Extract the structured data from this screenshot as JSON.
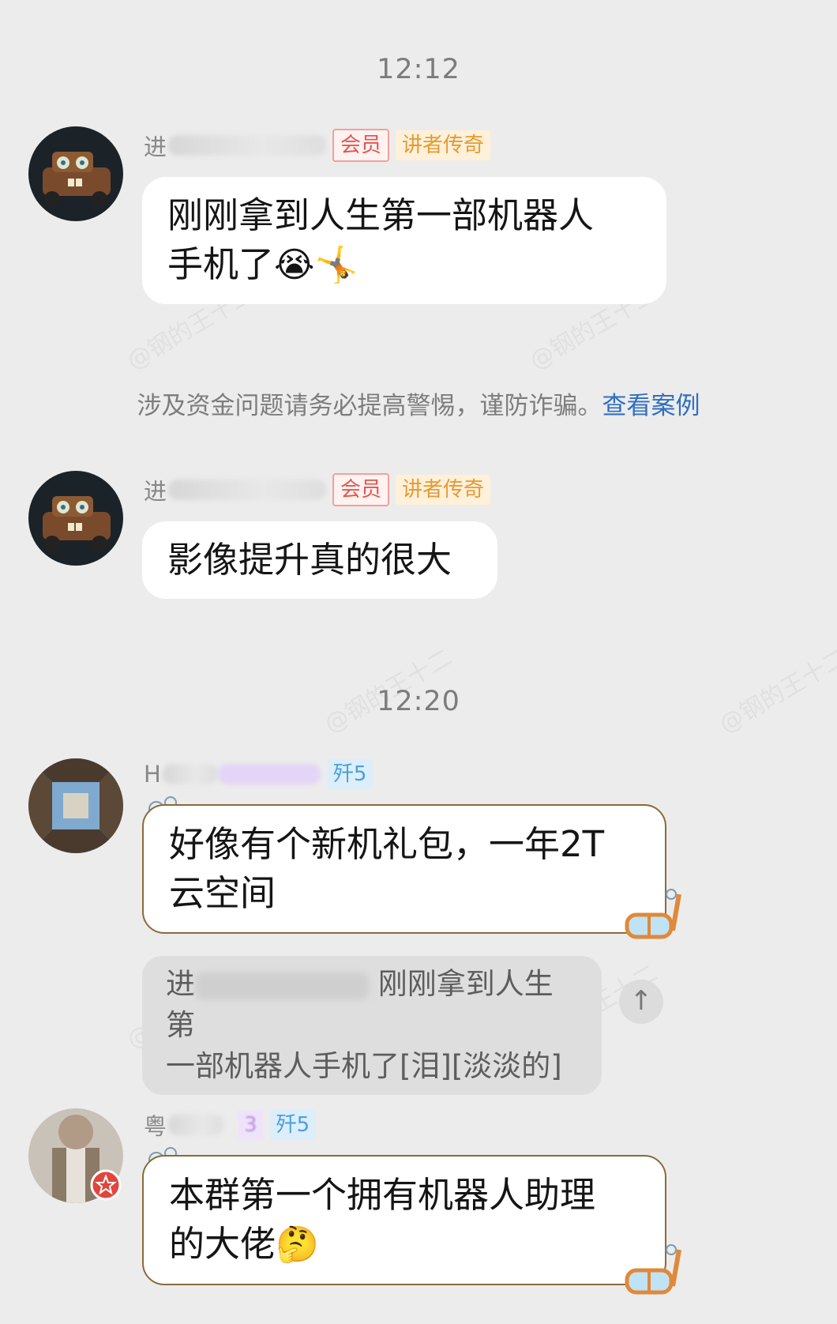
{
  "messages": [
    {
      "type": "time",
      "text": "12:12"
    },
    {
      "type": "chat",
      "name_initial": "进",
      "badges": [
        "会员",
        "讲者传奇"
      ],
      "text_line1": "刚刚拿到人生第一部机器人",
      "text_line2": "手机了",
      "emojis": [
        "😭",
        "🤸"
      ]
    },
    {
      "type": "notice",
      "text": "涉及资金问题请务必提高警惕，谨防诈骗。",
      "link": "查看案例"
    },
    {
      "type": "chat",
      "name_initial": "进",
      "badges": [
        "会员",
        "讲者传奇"
      ],
      "text": "影像提升真的很大"
    },
    {
      "type": "time",
      "text": "12:20"
    },
    {
      "type": "chat",
      "name_initial": "H",
      "badges": [
        "歼5"
      ],
      "text_line1": "好像有个新机礼包，一年2T",
      "text_line2": "云空间",
      "quote_prefix": "进",
      "quote_line1": "刚刚拿到人生第",
      "quote_line2": "一部机器人手机了[泪][淡淡的]",
      "quote_button": "↑"
    },
    {
      "type": "chat",
      "name_initial": "粤",
      "badges": [
        "3",
        "歼5"
      ],
      "text_line1": "本群第一个拥有机器人助理",
      "text_line2": "的大佬",
      "emojis": [
        "🤔"
      ]
    }
  ],
  "watermark": "@钢的王十二",
  "colors": {
    "background": "#ececec",
    "bubble": "#ffffff",
    "link": "#2f6fbf",
    "member_red": "#e2564f",
    "legend_orange": "#e49b32",
    "level_blue": "#4aa0d8"
  }
}
